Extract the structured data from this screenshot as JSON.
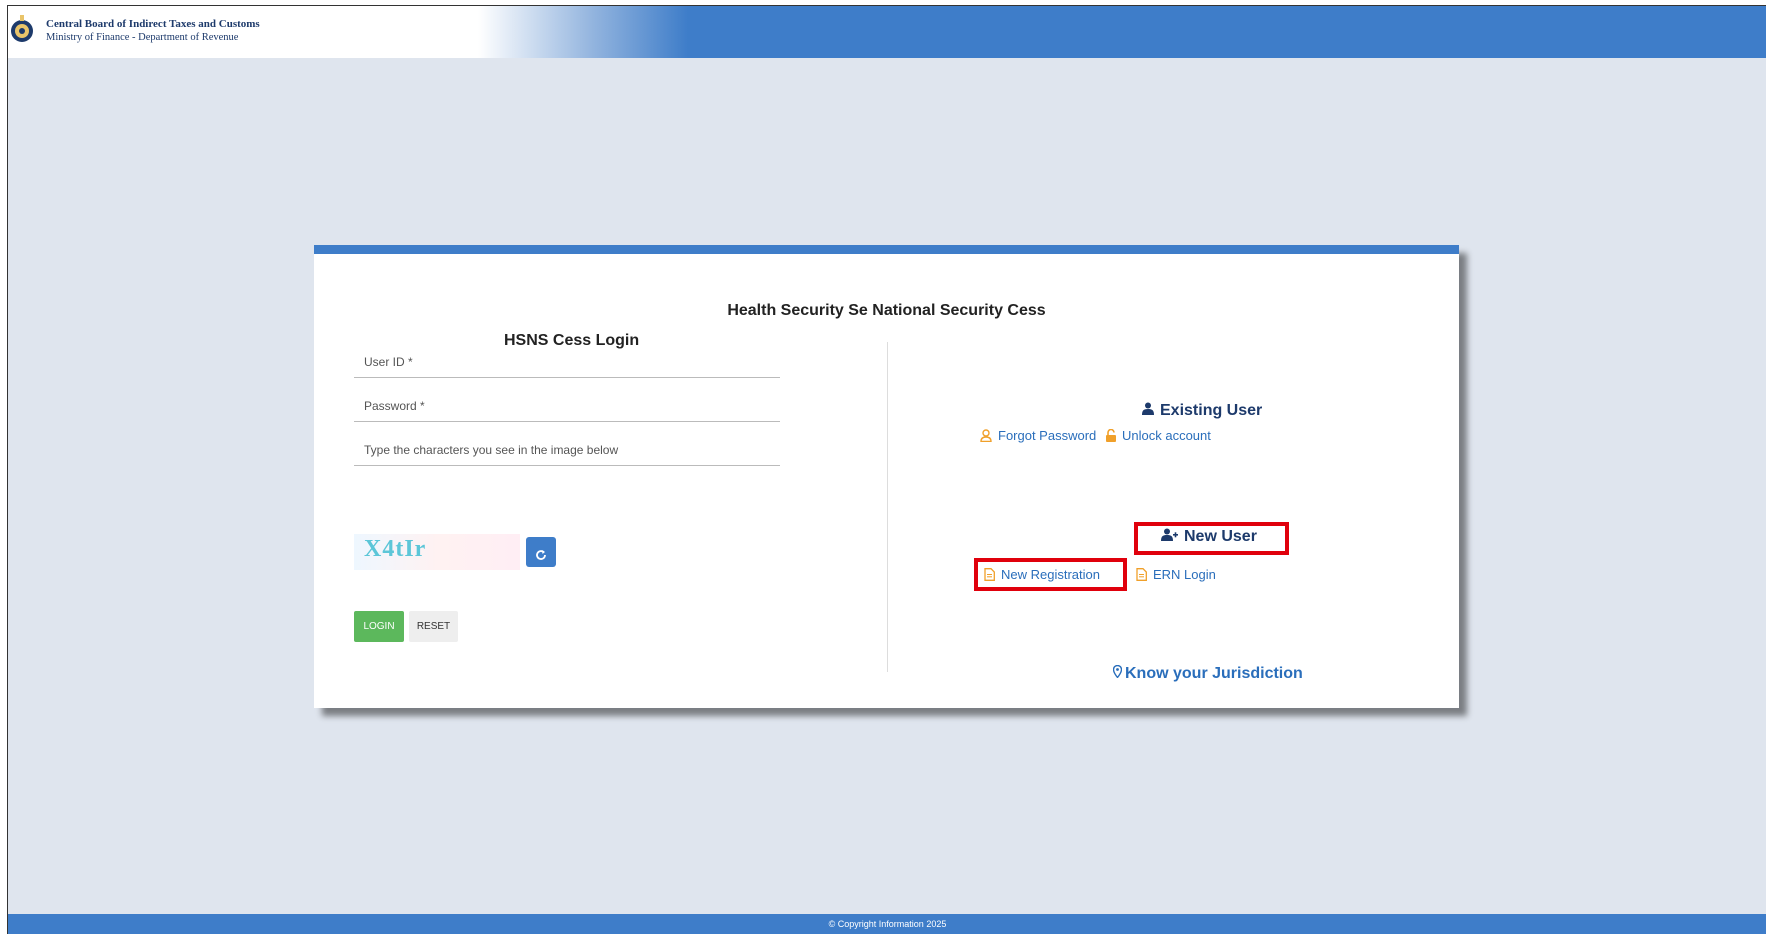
{
  "header": {
    "org_name": "Central Board of Indirect Taxes and Customs",
    "org_subtitle": "Ministry of Finance - Department of Revenue"
  },
  "card": {
    "main_title": "Health Security Se National Security Cess",
    "login_title": "HSNS Cess Login"
  },
  "login_form": {
    "user_id_placeholder": "User ID *",
    "password_placeholder": "Password *",
    "captcha_placeholder": "Type the characters you see in the image below",
    "captcha_text": "X4tIr",
    "login_label": "LOGIN",
    "reset_label": "RESET"
  },
  "existing_user": {
    "heading": "Existing User",
    "forgot_password": "Forgot Password",
    "unlock_account": "Unlock account"
  },
  "new_user": {
    "heading": "New User",
    "new_registration": "New Registration",
    "ern_login": "ERN Login"
  },
  "jurisdiction_link": "Know your Jurisdiction",
  "footer": {
    "copyright": "© Copyright Information 2025"
  },
  "colors": {
    "brand_blue": "#3e7dc9",
    "login_green": "#5cb85c",
    "highlight_red": "#e0000c",
    "link_blue": "#2a6ebb",
    "icon_orange": "#f0a02a"
  }
}
